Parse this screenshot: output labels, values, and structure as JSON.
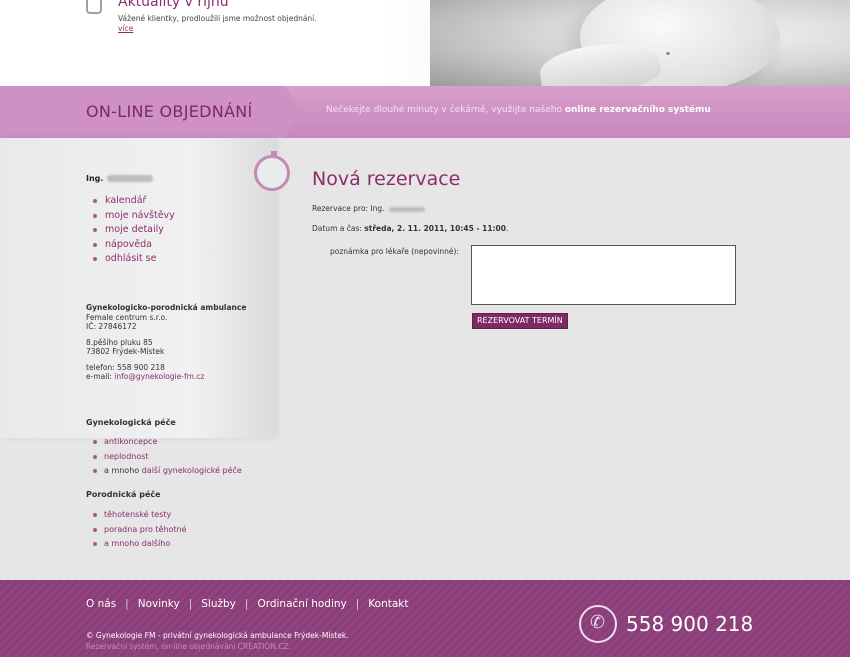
{
  "news": {
    "title": "Aktuality v říjnu",
    "text": "Vážené klientky, prodloužili jsme možnost objednání.",
    "more": "více"
  },
  "band": {
    "title": "ON-LINE OBJEDNÁNÍ",
    "slogan_regular": "Nečekejte dlouhé minuty v čekárně, využijte našeho ",
    "slogan_bold": "online rezervačního systému"
  },
  "sidebar": {
    "user_prefix": "Ing.",
    "menu": [
      "kalendář",
      "moje návštěvy",
      "moje detaily",
      "nápověda",
      "odhlásit se"
    ],
    "clinic": {
      "name": "Gynekologicko-porodnická ambulance",
      "company": "Female centrum s.r.o.",
      "ic": "IČ: 27846172",
      "street": "8.pěšího pluku 85",
      "city": "73802 Frýdek-Místek",
      "phone": "telefon: 558 900 218",
      "email_label": "e-mail: ",
      "email": "info@gynekologie-fm.cz"
    },
    "gyn": {
      "heading": "Gynekologická péče",
      "item1": "antikoncepce",
      "item2": "neplodnost",
      "item3_prefix": "a mnoho ",
      "item3_link": "další gynekologické péče"
    },
    "por": {
      "heading": "Porodnická péče",
      "item1": "těhotenské testy",
      "item2": "poradna pro těhotné",
      "item3": "a mnoho dalšího"
    }
  },
  "main": {
    "title": "Nová rezervace",
    "for_label": "Rezervace pro: Ing.",
    "date_label": "Datum a čas: ",
    "date_value": "středa, 2. 11. 2011, 10:45 - 11:00",
    "date_suffix": ".",
    "note_label": "poznámka pro lékaře (nepovinné):",
    "note_value": "",
    "submit": "REZERVOVAT TERMÍN"
  },
  "footer": {
    "nav": [
      "O nás",
      "Novinky",
      "Služby",
      "Ordinační hodiny",
      "Kontakt"
    ],
    "phone": "558 900 218",
    "copyright": "© Gynekologie FM - privátní gynekologická ambulance Frýdek-Místek.",
    "credits": "Rezervační systém, on-line objednávání CREATION.CZ."
  },
  "colors": {
    "accent": "#8b2e6b",
    "band": "#cf90c3",
    "footer": "#8a3e76"
  }
}
